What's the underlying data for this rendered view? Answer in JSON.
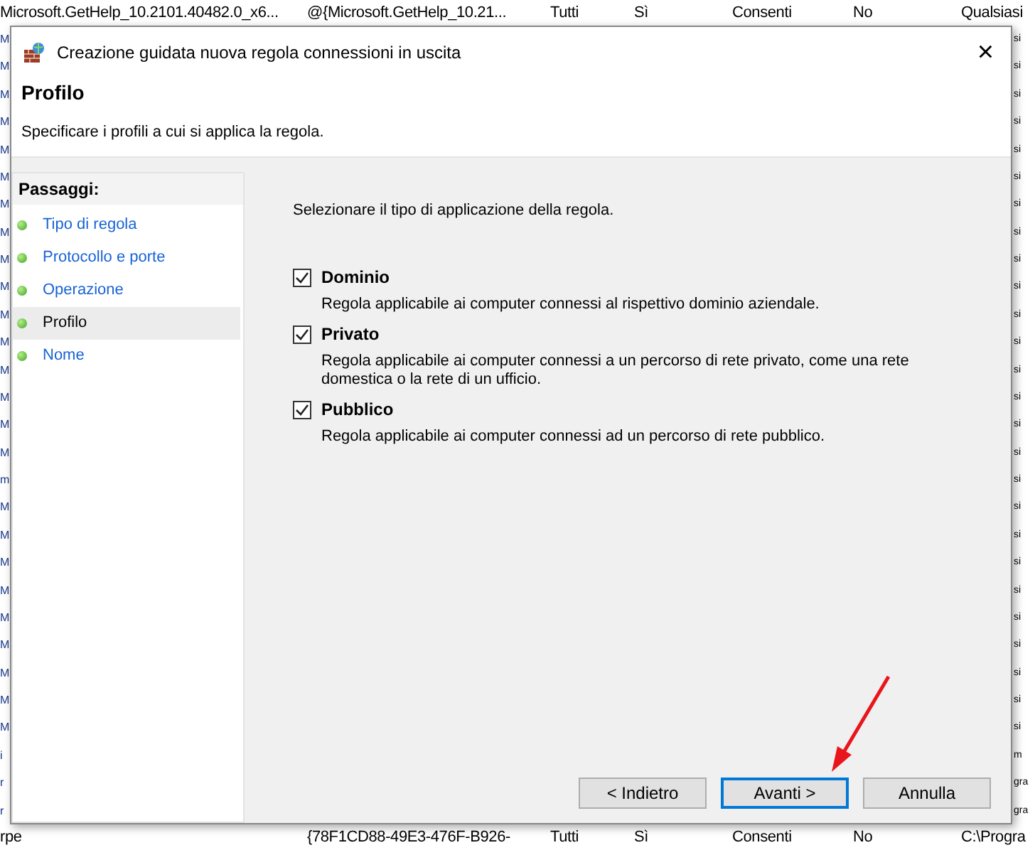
{
  "background_table": {
    "top_row": [
      "Microsoft.GetHelp_10.2101.40482.0_x6...",
      "@{Microsoft.GetHelp_10.21...",
      "Tutti",
      "Sì",
      "Consenti",
      "No",
      "Qualsiasi"
    ],
    "left_edge": [
      "M",
      "M",
      "M",
      "M",
      "M",
      "M",
      "M",
      "M",
      "M",
      "M",
      "M",
      "M",
      "M",
      "M",
      "M",
      "M",
      "m",
      "M",
      "M",
      "M",
      "M",
      "M",
      "M",
      "M",
      "M",
      "M",
      "i",
      "r",
      "r"
    ],
    "right_edge": [
      "si",
      "si",
      "si",
      "si",
      "si",
      "si",
      "si",
      "si",
      "si",
      "si",
      "si",
      "si",
      "si",
      "si",
      "si",
      "si",
      "si",
      "si",
      "si",
      "si",
      "si",
      "si",
      "si",
      "si",
      "si",
      "si",
      "m",
      "gra",
      "gra"
    ],
    "bottom_row": [
      "rpe",
      "{78F1CD88-49E3-476F-B926-",
      "Tutti",
      "Sì",
      "Consenti",
      "No",
      "C:\\Progra"
    ]
  },
  "window": {
    "title": "Creazione guidata nuova regola connessioni in uscita",
    "close": "×"
  },
  "header": {
    "title": "Profilo",
    "subtitle": "Specificare i profili a cui si applica la regola."
  },
  "steps": {
    "title": "Passaggi:",
    "items": [
      {
        "label": "Tipo di regola",
        "selected": false
      },
      {
        "label": "Protocollo e porte",
        "selected": false
      },
      {
        "label": "Operazione",
        "selected": false
      },
      {
        "label": "Profilo",
        "selected": true
      },
      {
        "label": "Nome",
        "selected": false
      }
    ]
  },
  "content": {
    "instruction": "Selezionare il tipo di applicazione della regola.",
    "profiles": [
      {
        "label": "Dominio",
        "checked": true,
        "description": "Regola applicabile ai computer connessi al rispettivo dominio aziendale."
      },
      {
        "label": "Privato",
        "checked": true,
        "description": "Regola applicabile ai computer connessi a un percorso di rete privato, come una rete domestica o la rete di un ufficio."
      },
      {
        "label": "Pubblico",
        "checked": true,
        "description": "Regola applicabile ai computer connessi ad un percorso di rete pubblico."
      }
    ]
  },
  "buttons": [
    {
      "label": "< Indietro",
      "default": false
    },
    {
      "label": "Avanti >",
      "default": true
    },
    {
      "label": "Annulla",
      "default": false
    }
  ]
}
